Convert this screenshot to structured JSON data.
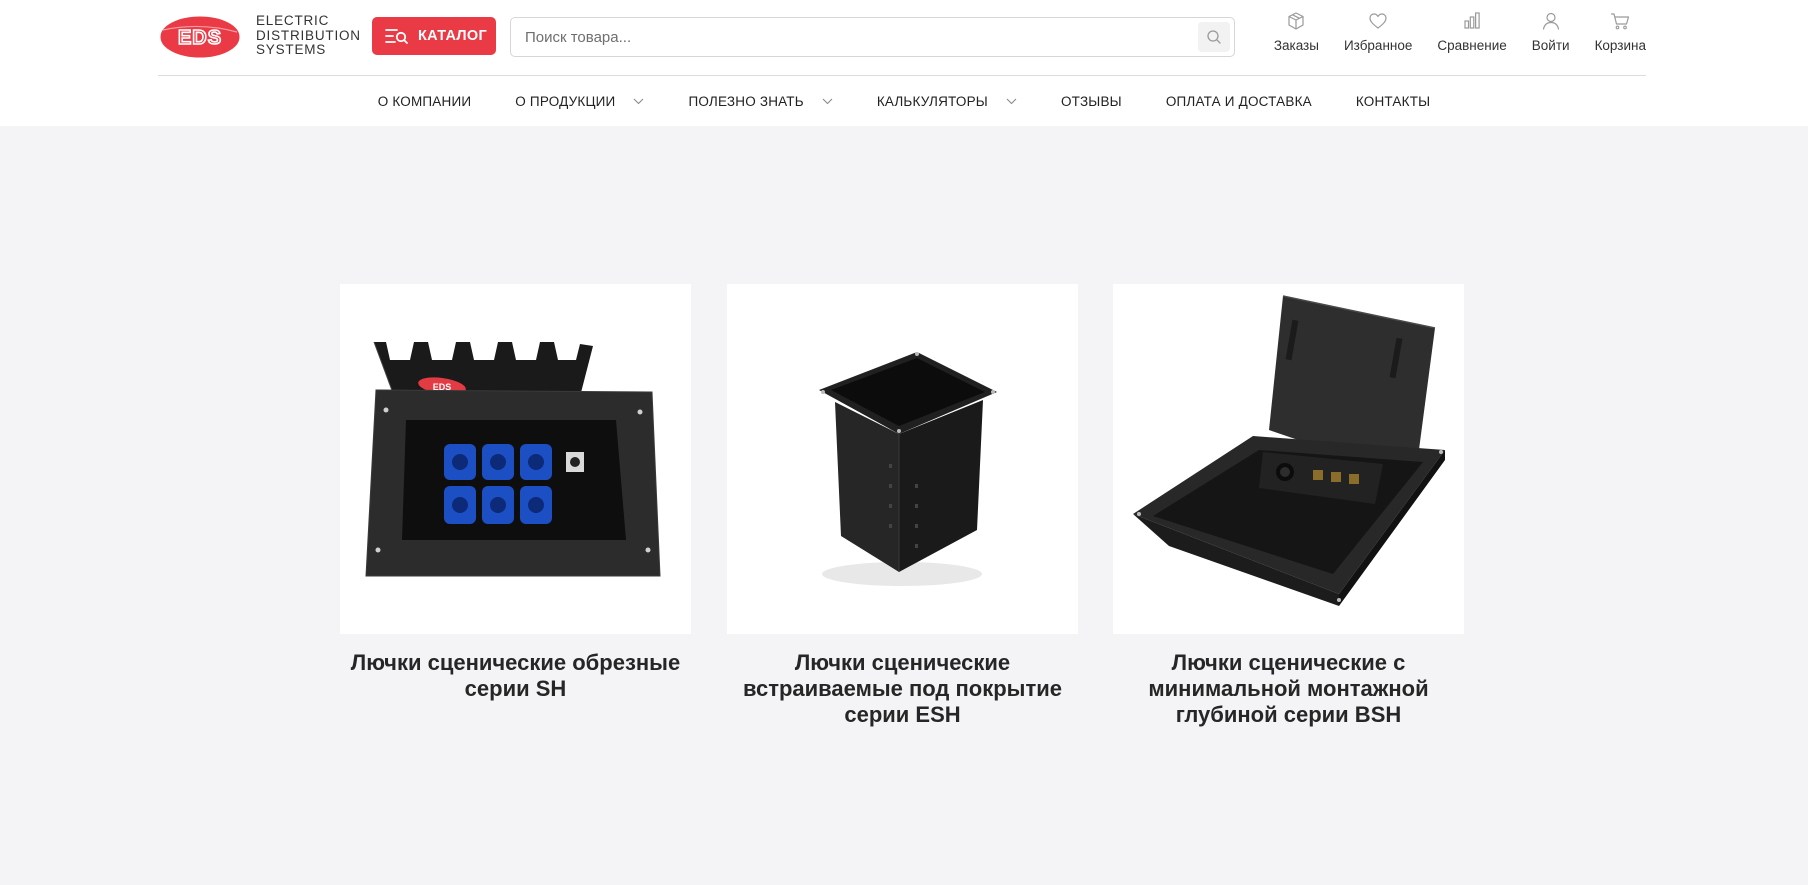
{
  "brand": {
    "logo_text": "EDS",
    "tagline_lines": [
      "ELECTRIC",
      "DISTRIBUTION",
      "SYSTEMS"
    ],
    "accent_color": "#ea3a45"
  },
  "catalog_button": {
    "label": "КАТАЛОГ",
    "icon": "catalog-search-icon"
  },
  "search": {
    "placeholder": "Поиск товара...",
    "value": "",
    "icon": "search-icon"
  },
  "actions": [
    {
      "label": "Заказы",
      "icon": "box-icon"
    },
    {
      "label": "Избранное",
      "icon": "heart-icon"
    },
    {
      "label": "Сравнение",
      "icon": "bar-chart-icon"
    },
    {
      "label": "Войти",
      "icon": "user-icon"
    },
    {
      "label": "Корзина",
      "icon": "cart-icon"
    }
  ],
  "nav": [
    {
      "label": "О КОМПАНИИ",
      "has_dropdown": false
    },
    {
      "label": "О ПРОДУКЦИИ",
      "has_dropdown": true
    },
    {
      "label": "ПОЛЕЗНО ЗНАТЬ",
      "has_dropdown": true
    },
    {
      "label": "КАЛЬКУЛЯТОРЫ",
      "has_dropdown": true
    },
    {
      "label": "ОТЗЫВЫ",
      "has_dropdown": false
    },
    {
      "label": "ОПЛАТА И ДОСТАВКА",
      "has_dropdown": false
    },
    {
      "label": "КОНТАКТЫ",
      "has_dropdown": false
    }
  ],
  "products": [
    {
      "title": "Лючки сценические обрезные серии SH",
      "image": "floor-box-sh-image"
    },
    {
      "title": "Лючки сценические встраиваемые под покрытие серии ESH",
      "image": "floor-box-esh-image"
    },
    {
      "title": "Лючки сценические с минимальной монтажной глубиной серии BSH",
      "image": "floor-box-bsh-image"
    }
  ]
}
